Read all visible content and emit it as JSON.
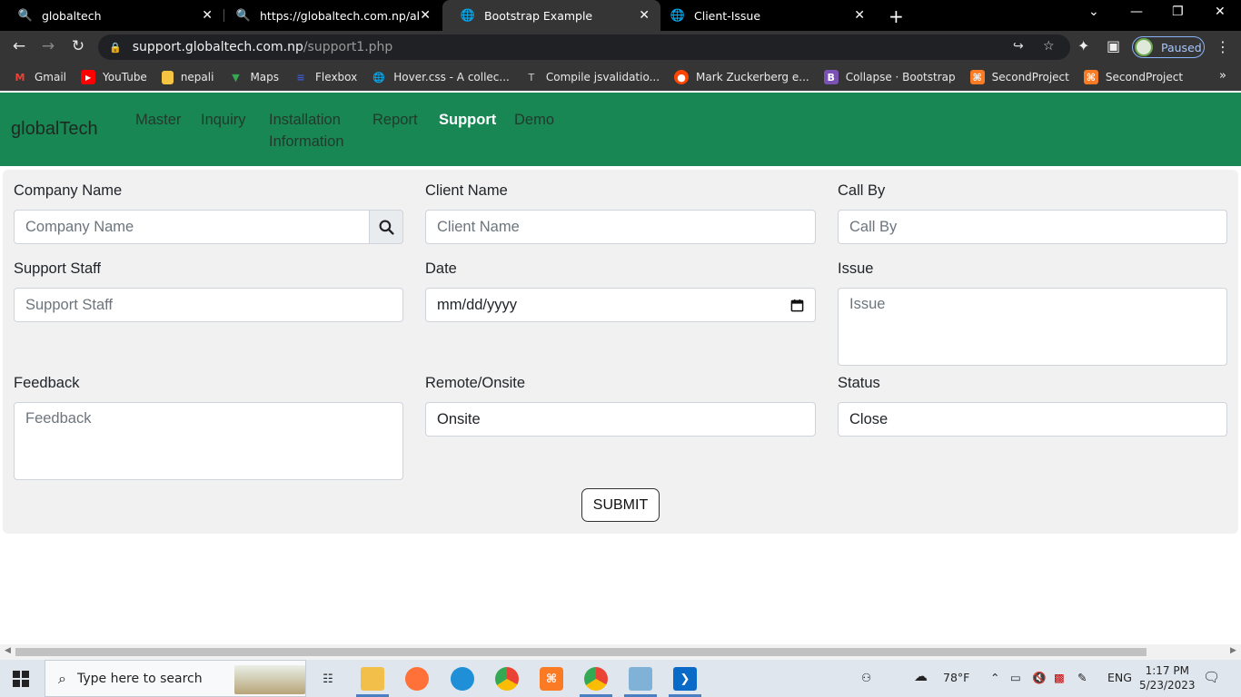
{
  "browser": {
    "tabs": [
      {
        "title": "globaltech",
        "icon": "globaltech-favicon"
      },
      {
        "title": "https://globaltech.com.np/about",
        "icon": "globaltech-favicon"
      },
      {
        "title": "Bootstrap Example",
        "icon": "globe-icon"
      },
      {
        "title": "Client-Issue",
        "icon": "globe-icon"
      }
    ],
    "url_host": "support.globaltech.com.np",
    "url_path": "/support1.php",
    "profile_label": "Paused",
    "bookmarks": [
      {
        "label": "Gmail",
        "icon": "gmail-icon",
        "color": "#ea4335"
      },
      {
        "label": "YouTube",
        "icon": "youtube-icon",
        "color": "#ff0000"
      },
      {
        "label": "nepali",
        "icon": "folder-icon",
        "color": "#f5c542"
      },
      {
        "label": "Maps",
        "icon": "maps-icon",
        "color": "#34a853"
      },
      {
        "label": "Flexbox",
        "icon": "flexbox-icon",
        "color": "#3b5bdb"
      },
      {
        "label": "Hover.css - A collec...",
        "icon": "globe-icon",
        "color": "#ffffff"
      },
      {
        "label": "Compile jsvalidatio...",
        "icon": "text-icon",
        "color": "#cccccc"
      },
      {
        "label": "Mark Zuckerberg e...",
        "icon": "reddit-icon",
        "color": "#ff4500"
      },
      {
        "label": "Collapse · Bootstrap",
        "icon": "bootstrap-icon",
        "color": "#7952b3"
      },
      {
        "label": "SecondProject",
        "icon": "xampp-icon",
        "color": "#fb7a24"
      },
      {
        "label": "SecondProject",
        "icon": "xampp-icon",
        "color": "#fb7a24"
      }
    ]
  },
  "navbar": {
    "brand": "globalTech",
    "links": [
      {
        "label": "Master"
      },
      {
        "label": "Inquiry"
      },
      {
        "label": "Installation Information"
      },
      {
        "label": "Report"
      },
      {
        "label": "Support"
      },
      {
        "label": "Demo"
      }
    ],
    "active_link": "Support",
    "color": "#198754"
  },
  "form": {
    "company_name": {
      "label": "Company Name",
      "placeholder": "Company Name"
    },
    "client_name": {
      "label": "Client Name",
      "placeholder": "Client Name"
    },
    "call_by": {
      "label": "Call By",
      "placeholder": "Call By"
    },
    "support_staff": {
      "label": "Support Staff",
      "placeholder": "Support Staff"
    },
    "date": {
      "label": "Date",
      "value": "mm/dd/yyyy"
    },
    "issue": {
      "label": "Issue",
      "placeholder": "Issue"
    },
    "feedback": {
      "label": "Feedback",
      "placeholder": "Feedback"
    },
    "remote_onsite": {
      "label": "Remote/Onsite",
      "value": "Onsite"
    },
    "status": {
      "label": "Status",
      "value": "Close"
    },
    "submit_label": "SUBMIT"
  },
  "taskbar": {
    "search_placeholder": "Type here to search",
    "weather": "78°F",
    "language": "ENG",
    "time": "1:17 PM",
    "date": "5/23/2023"
  }
}
